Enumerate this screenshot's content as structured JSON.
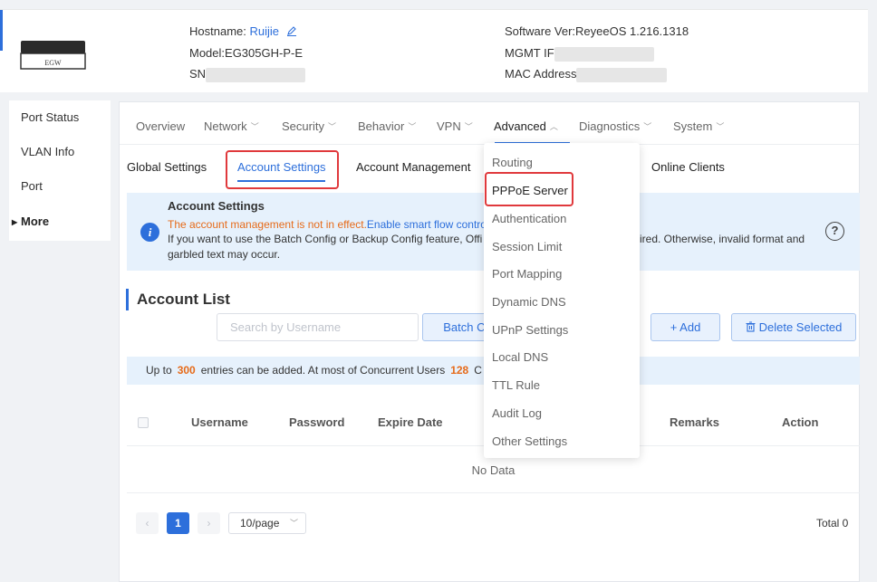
{
  "header": {
    "hostname_label": "Hostname: ",
    "hostname_value": "Ruijie",
    "model": "Model:EG305GH-P-E",
    "sn_label": "SN",
    "software": "Software Ver:ReyeeOS 1.216.1318",
    "mgmt_label": "MGMT IF",
    "mac_label": "MAC Address",
    "device_label": "EGW"
  },
  "sidebar": {
    "items": [
      {
        "label": "Port Status"
      },
      {
        "label": "VLAN Info"
      },
      {
        "label": "Port"
      },
      {
        "label": "More"
      }
    ]
  },
  "topnav": {
    "tabs": [
      {
        "label": "Overview"
      },
      {
        "label": "Network"
      },
      {
        "label": "Security"
      },
      {
        "label": "Behavior"
      },
      {
        "label": "VPN"
      },
      {
        "label": "Advanced"
      },
      {
        "label": "Diagnostics"
      },
      {
        "label": "System"
      }
    ]
  },
  "subtabs": {
    "items": [
      {
        "label": "Global Settings"
      },
      {
        "label": "Account Settings"
      },
      {
        "label": "Account Management"
      },
      {
        "label": "Online Clients"
      }
    ]
  },
  "banner": {
    "title": "Account Settings",
    "warn_text": "The account management is not in effect.",
    "warn_link": "Enable smart flow contro",
    "line2_left": "If you want to use the Batch Config or Backup Config feature, Offi",
    "line2_right": "ired. Otherwise, invalid format and",
    "line3": "garbled text may occur."
  },
  "account_list": {
    "title": "Account List",
    "search_placeholder": "Search by Username",
    "batch_button": "Batch Co",
    "add_button": "+ Add",
    "delete_button": "Delete Selected",
    "limit_prefix": "Up to",
    "limit_entries": "300",
    "limit_middle": "entries can be added. At most of Concurrent Users",
    "limit_users": "128",
    "limit_suffix": "C",
    "columns": [
      "Username",
      "Password",
      "Expire Date",
      "Remarks",
      "Action"
    ],
    "no_data": "No Data"
  },
  "pagination": {
    "current_page": "1",
    "page_size": "10/page",
    "total": "Total 0"
  },
  "advanced_menu": {
    "items": [
      {
        "label": "Routing"
      },
      {
        "label": "PPPoE Server"
      },
      {
        "label": "Authentication"
      },
      {
        "label": "Session Limit"
      },
      {
        "label": "Port Mapping"
      },
      {
        "label": "Dynamic DNS"
      },
      {
        "label": "UPnP Settings"
      },
      {
        "label": "Local DNS"
      },
      {
        "label": "TTL Rule"
      },
      {
        "label": "Audit Log"
      },
      {
        "label": "Other Settings"
      }
    ]
  },
  "colors": {
    "accent": "#2d6fdb",
    "highlight_box": "#e0393c",
    "warning": "#e66b1a",
    "info_bg": "#e6f1fc"
  }
}
